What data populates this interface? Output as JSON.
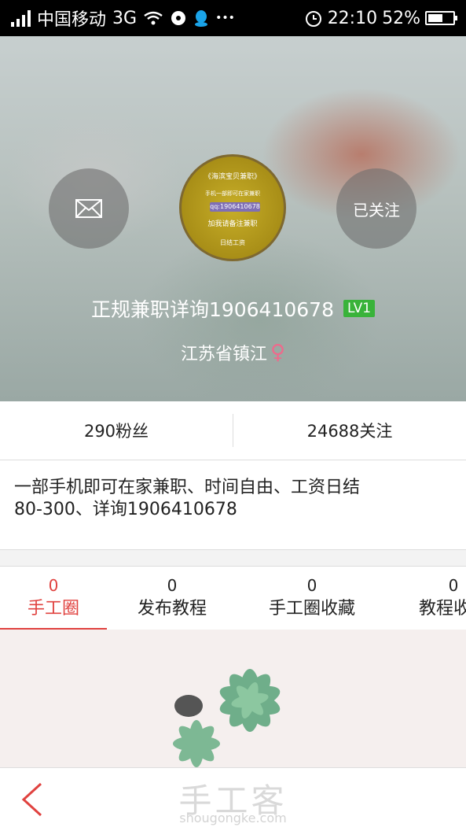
{
  "status_bar": {
    "carrier": "中国移动",
    "network": "3G",
    "time": "22:10",
    "battery": "52%",
    "more": "•••"
  },
  "profile": {
    "message_icon": "envelope-icon",
    "follow_label": "已关注",
    "avatar_lines": [
      "《海滨宝贝兼职》",
      "手机一部即可在家兼职",
      "qq:1906410678",
      "加我请备注兼职",
      "日结工资"
    ],
    "name": "正规兼职详询1906410678",
    "level": "LV1",
    "location": "江苏省镇江",
    "gender_symbol": "♀"
  },
  "stats": {
    "fans": "290粉丝",
    "following": "24688关注"
  },
  "bio": {
    "line1": "一部手机即可在家兼职、时间自由、工资日结",
    "line2": "80-300、详询1906410678"
  },
  "tabs": [
    {
      "count": "0",
      "label": "手工圈"
    },
    {
      "count": "0",
      "label": "发布教程"
    },
    {
      "count": "0",
      "label": "手工圈收藏"
    },
    {
      "count": "0",
      "label": "教程收藏"
    }
  ],
  "bottom": {
    "back_icon": "chevron-left-icon",
    "watermark": "手工客",
    "watermark_url": "shougongke.com"
  },
  "colors": {
    "accent": "#e0423f",
    "level_badge": "#39b33a",
    "female": "#ee6a8c"
  }
}
